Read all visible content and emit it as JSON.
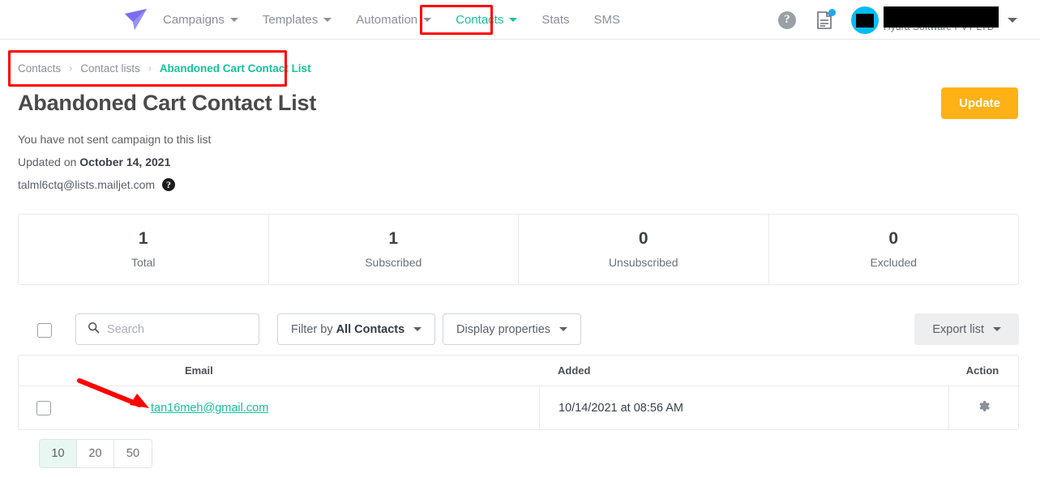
{
  "nav": {
    "logo_icon": "paper-plane-logo",
    "items": [
      {
        "label": "Campaigns",
        "has_caret": true,
        "active": false
      },
      {
        "label": "Templates",
        "has_caret": true,
        "active": false
      },
      {
        "label": "Automation",
        "has_caret": true,
        "active": false
      },
      {
        "label": "Contacts",
        "has_caret": true,
        "active": true
      },
      {
        "label": "Stats",
        "has_caret": false,
        "active": false
      },
      {
        "label": "SMS",
        "has_caret": false,
        "active": false
      }
    ],
    "help_icon_glyph": "?",
    "doc_icon": "document-icon",
    "notification_dot_color": "#1fa8f0",
    "avatar_color": "#00bcf2",
    "account_name": "Hydra Software PVT LTD",
    "account_caret": "chevron-down-icon"
  },
  "breadcrumb": {
    "items": [
      "Contacts",
      "Contact lists",
      "Abandoned Cart Contact List"
    ],
    "separator": "›"
  },
  "page": {
    "title": "Abandoned Cart Contact List",
    "update_label": "Update",
    "campaign_note": "You have not sent campaign to this list",
    "updated_prefix": "Updated on ",
    "updated_date": "October 14, 2021",
    "list_email": "talml6ctq@lists.mailjet.com",
    "help_glyph": "?"
  },
  "stats": [
    {
      "value": "1",
      "label": "Total"
    },
    {
      "value": "1",
      "label": "Subscribed"
    },
    {
      "value": "0",
      "label": "Unsubscribed"
    },
    {
      "value": "0",
      "label": "Excluded"
    }
  ],
  "toolbar": {
    "search_placeholder": "Search",
    "search_value": "",
    "search_icon": "search-icon",
    "filter_prefix": "Filter by ",
    "filter_value": "All Contacts",
    "display_properties_label": "Display properties",
    "export_label": "Export list"
  },
  "table": {
    "columns": [
      "Email",
      "Added",
      "Action"
    ],
    "rows": [
      {
        "email": "tan16meh@gmail.com",
        "added": "10/14/2021 at 08:56 AM",
        "action_icon": "gear-icon"
      }
    ]
  },
  "pagination": {
    "options": [
      "10",
      "20",
      "50"
    ],
    "selected": "10"
  },
  "annotations": {
    "highlight_color": "#ff0000",
    "arrow_target": "tan16meh@gmail.com",
    "boxes": [
      "contacts-nav-item",
      "breadcrumb"
    ]
  },
  "colors": {
    "accent_teal": "#15c39a",
    "update_orange": "#ffb116",
    "logo_purple": "#7b6ff0",
    "annotation_red": "#ff0000"
  }
}
